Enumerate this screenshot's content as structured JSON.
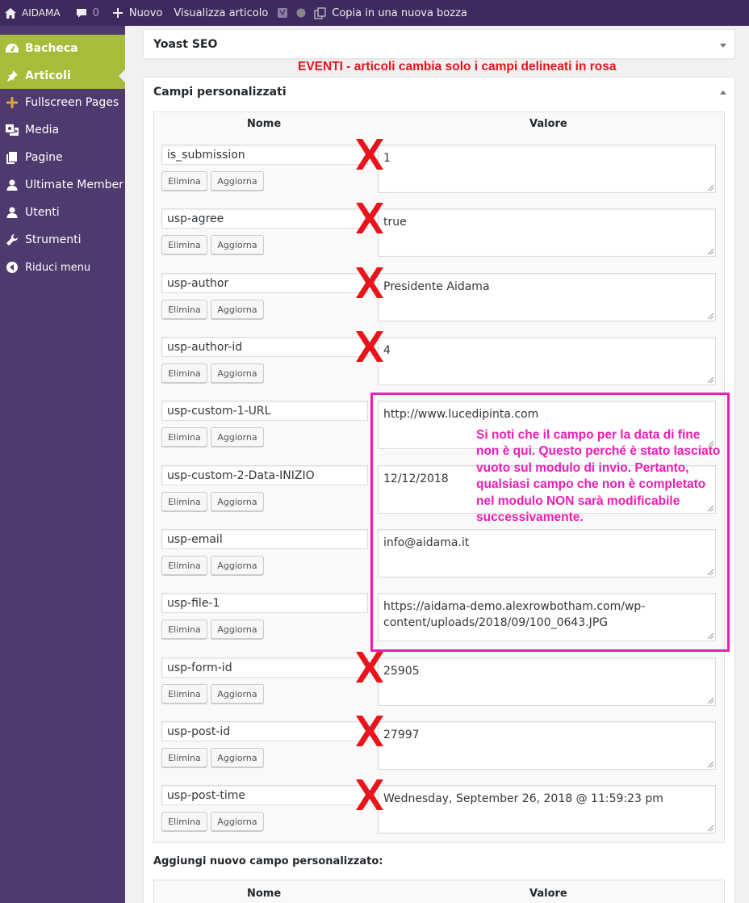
{
  "adminbar": {
    "site_name": "AIDAMA",
    "comments_count": "0",
    "new_label": "Nuovo",
    "view_post": "Visualizza articolo",
    "copy_draft": "Copia in una nuova bozza"
  },
  "sidebar": {
    "items": [
      {
        "label": "Bacheca",
        "icon": "dashboard-icon"
      },
      {
        "label": "Articoli",
        "icon": "pin-icon"
      },
      {
        "label": "Fullscreen Pages",
        "icon": "plus-icon"
      },
      {
        "label": "Media",
        "icon": "media-icon"
      },
      {
        "label": "Pagine",
        "icon": "pages-icon"
      },
      {
        "label": "Ultimate Member",
        "icon": "user-icon"
      },
      {
        "label": "Utenti",
        "icon": "users-icon"
      },
      {
        "label": "Strumenti",
        "icon": "wrench-icon"
      },
      {
        "label": "Riduci menu",
        "icon": "collapse-icon"
      }
    ],
    "colors": {
      "bg": "#4e3a6e",
      "active": "#a5bd3b"
    }
  },
  "yoast": {
    "title": "Yoast SEO"
  },
  "annotation_top": "EVENTI - articoli cambia solo i campi delineati in rosa",
  "custom_fields": {
    "title": "Campi personalizzati",
    "col_name": "Nome",
    "col_value": "Valore",
    "delete_label": "Elimina",
    "update_label": "Aggiorna",
    "rows": [
      {
        "name": "is_submission",
        "value": "1"
      },
      {
        "name": "usp-agree",
        "value": "true"
      },
      {
        "name": "usp-author",
        "value": "Presidente Aidama"
      },
      {
        "name": "usp-author-id",
        "value": "4"
      },
      {
        "name": "usp-custom-1-URL",
        "value": "http://www.lucedipinta.com"
      },
      {
        "name": "usp-custom-2-Data-INIZIO",
        "value": "12/12/2018"
      },
      {
        "name": "usp-email",
        "value": "info@aidama.it"
      },
      {
        "name": "usp-file-1",
        "value": "https://aidama-demo.alexrowbotham.com/wp-content/uploads/2018/09/100_0643.JPG"
      },
      {
        "name": "usp-form-id",
        "value": "25905"
      },
      {
        "name": "usp-post-id",
        "value": "27997"
      },
      {
        "name": "usp-post-time",
        "value": "Wednesday, September 26, 2018 @ 11:59:23 pm"
      }
    ],
    "add_new_label": "Aggiungi nuovo campo personalizzato:"
  },
  "pink_note": "Si noti che il campo per la data di fine non è qui. Questo perché è stato lasciato vuoto sul modulo di invio. Pertanto, qualsiasi campo che non è completato nel modulo NON sarà modificabile successivamente.",
  "colors": {
    "annotation_red": "#e8141b",
    "annotation_pink": "#ee1cb6"
  }
}
